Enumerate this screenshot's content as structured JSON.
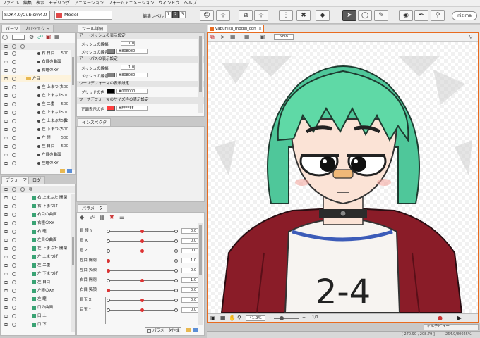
{
  "menu": [
    "ファイル",
    "編集",
    "表示",
    "モデリング",
    "アニメーション",
    "フォームアニメーション",
    "ウィンドウ",
    "ヘルプ"
  ],
  "toolbar": {
    "project_combo": "SDK4.0/Cubism4.0",
    "model_combo": "Model",
    "edit_level_label": "編集レベル :",
    "levels": [
      "1",
      "2",
      "3"
    ],
    "brand": "nizima"
  },
  "left_panel": {
    "tabs": [
      "パーツ",
      "プロジェクト"
    ],
    "rows": [
      {
        "label": "右 白目",
        "value": "500"
      },
      {
        "label": "右目の曲面",
        "value": ""
      },
      {
        "label": "右瞳のXY",
        "value": ""
      },
      {
        "label": "左目",
        "value": "",
        "folder": true
      },
      {
        "label": "左 上まつげ",
        "value": "500"
      },
      {
        "label": "左 上まぶた",
        "value": "500"
      },
      {
        "label": "左 二重",
        "value": "500"
      },
      {
        "label": "左 上まぶた",
        "value": "500"
      },
      {
        "label": "左 上まぶた 影",
        "value": "500"
      },
      {
        "label": "左 下まつげ",
        "value": "500"
      },
      {
        "label": "左 瞳",
        "value": "500"
      },
      {
        "label": "左 白目",
        "value": "500"
      },
      {
        "label": "左目の曲面",
        "value": ""
      },
      {
        "label": "左瞳のXY",
        "value": ""
      }
    ]
  },
  "deformer_panel": {
    "tabs": [
      "デフォーマ",
      "ログ"
    ],
    "rows": [
      "右 上まぶた 開閉",
      "右 下まつげ",
      "右目の曲面",
      "右瞳のXY",
      "右 瞳",
      "左目の曲面",
      "左 上まぶた 開閉",
      "左 上まつげ",
      "左 二重",
      "左 下まつげ",
      "左 白目",
      "左瞳のXY",
      "左 瞳",
      "口の曲面",
      "口 上",
      "口 下"
    ]
  },
  "tool_detail": {
    "tab": "ツール詳細",
    "sections": [
      {
        "header": "アートメッシュの表示設定",
        "items": [
          {
            "label": "メッシュの線幅",
            "value": "1.0"
          },
          {
            "label": "メッシュの線色",
            "value": "#808080",
            "color": "#808080"
          }
        ]
      },
      {
        "header": "アートパスの表示設定",
        "items": [
          {
            "label": "メッシュの線幅",
            "value": "1.0"
          },
          {
            "label": "メッシュの線色",
            "value": "#808080",
            "color": "#808080"
          }
        ]
      },
      {
        "header": "ワープデフォーマの表示設定",
        "items": [
          {
            "label": "グリッドの色",
            "value": "#000000",
            "color": "#000000"
          }
        ]
      },
      {
        "header": "ワープデフォーマのサイズ枠の表示設定",
        "items": [
          {
            "label": "正面表示の色",
            "value": "#FFFFFF",
            "color": "#ff4040"
          }
        ]
      }
    ]
  },
  "inspector": {
    "tab": "インスペクタ"
  },
  "parameters": {
    "tab": "パラメータ",
    "rows": [
      {
        "label": "目 瞳 Y",
        "value": "0.0",
        "knob": 0.5
      },
      {
        "label": "眉 X",
        "value": "0.0",
        "knob": 0.5
      },
      {
        "label": "眉 Z",
        "value": "0.0",
        "knob": 0.5
      },
      {
        "label": "左目 開閉",
        "value": "1.0",
        "knob": 0.0
      },
      {
        "label": "左目 笑顔",
        "value": "0.0",
        "knob": 0.0
      },
      {
        "label": "右目 開閉",
        "value": "1.0",
        "knob": 0.5
      },
      {
        "label": "右目 笑顔",
        "value": "0.0",
        "knob": 0.0
      },
      {
        "label": "目玉 X",
        "value": "0.0",
        "knob": 0.5
      },
      {
        "label": "目玉 Y",
        "value": "0.0",
        "knob": 0.5
      }
    ],
    "create_button": "パラメータ作成"
  },
  "viewport": {
    "tab_title": "vabuniku_model_con",
    "solo_label": "Solo",
    "shirt_text": "2-4",
    "zoom": "41.9%",
    "ratio": "1/1",
    "multiview": "マルチビュー",
    "status": "[ 270.90 , 208.79 ]",
    "status2": "264.9/80025%"
  },
  "colors": {
    "accent": "#e86b1f",
    "hair": "#5fd9a6",
    "jacket": "#8a1c28",
    "skin": "#fbe3d6"
  }
}
